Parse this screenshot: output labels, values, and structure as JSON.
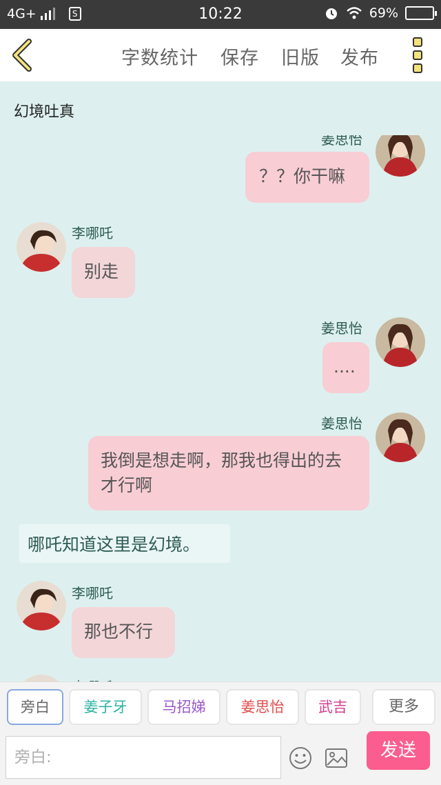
{
  "status_bar": {
    "network": "4G+",
    "time": "10:22",
    "battery": "69%"
  },
  "toolbar": {
    "word_count": "字数统计",
    "save": "保存",
    "old_version": "旧版",
    "publish": "发布"
  },
  "chat": {
    "title": "幻境吐真",
    "messages": [
      {
        "speaker": "姜思怡",
        "text": "？？你干嘛"
      },
      {
        "speaker": "李哪吒",
        "text": "别走"
      },
      {
        "speaker": "姜思怡",
        "text": "...."
      },
      {
        "speaker": "姜思怡",
        "text": "我倒是想走啊，那我也得出的去才行啊"
      },
      {
        "narration": "哪吒知道这里是幻境。"
      },
      {
        "speaker": "李哪吒",
        "text": "那也不行"
      },
      {
        "speaker": "李哪吒"
      }
    ]
  },
  "roles": [
    {
      "label": "旁白",
      "color": "#666666"
    },
    {
      "label": "姜子牙",
      "color": "#2bb3a3"
    },
    {
      "label": "马招娣",
      "color": "#9b59c8"
    },
    {
      "label": "姜思怡",
      "color": "#e24d4d"
    },
    {
      "label": "武吉",
      "color": "#d63d8f"
    }
  ],
  "more_label": "更多",
  "input": {
    "placeholder": "旁白:"
  },
  "send_label": "发送",
  "icons": [
    "back-arrow-icon",
    "menu-icon",
    "emoji-icon",
    "image-icon",
    "signal-icon",
    "sim-icon",
    "alarm-icon",
    "wifi-icon",
    "battery-icon"
  ]
}
